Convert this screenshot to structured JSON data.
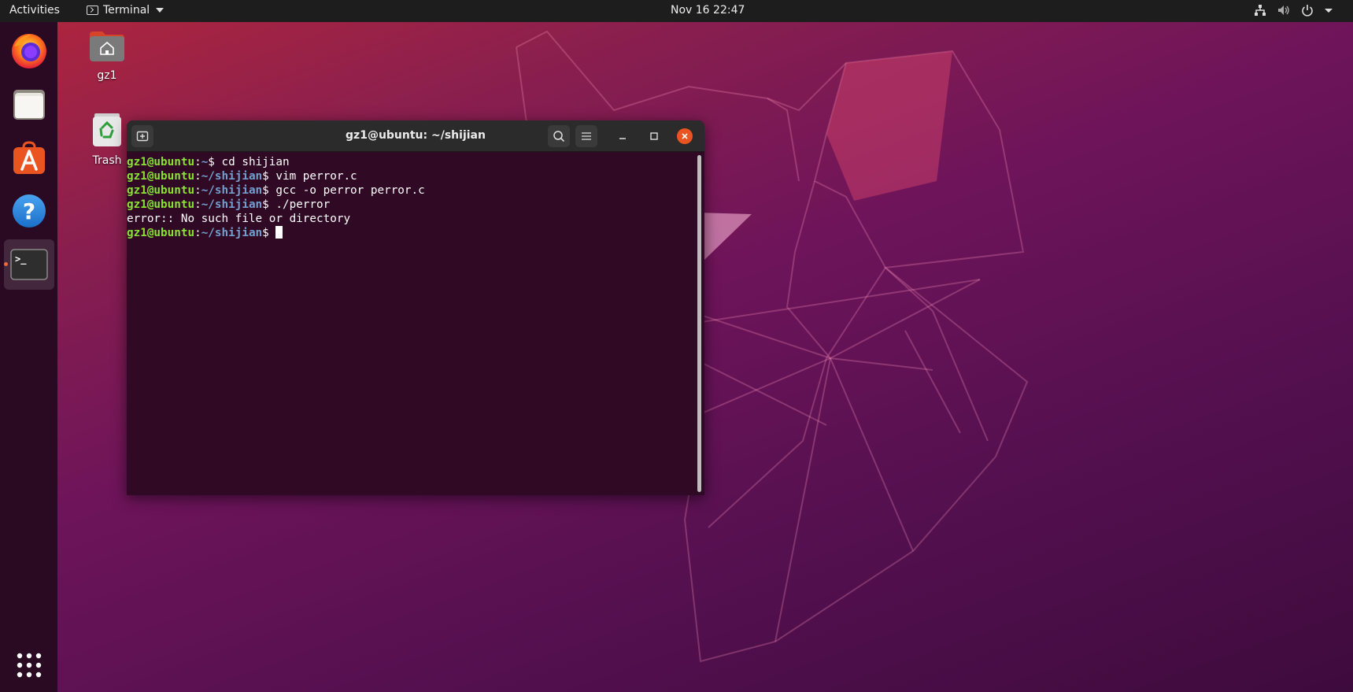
{
  "topbar": {
    "activities_label": "Activities",
    "app_menu_label": "Terminal",
    "clock": "Nov 16  22:47",
    "tray_icons": [
      "network-icon",
      "volume-icon",
      "power-icon",
      "chevron-down-icon"
    ]
  },
  "dock": {
    "items": [
      {
        "name": "firefox",
        "icon": "firefox-icon"
      },
      {
        "name": "files",
        "icon": "folder-icon"
      },
      {
        "name": "software",
        "icon": "app-store-icon"
      },
      {
        "name": "help",
        "icon": "help-icon"
      },
      {
        "name": "terminal",
        "icon": "terminal-icon",
        "active": true
      }
    ],
    "show_apps_icon": "grid-icon",
    "terminal_glyph": ">_"
  },
  "desktop": {
    "icons": [
      {
        "label": "gz1",
        "icon": "home-folder-icon"
      },
      {
        "label": "Trash",
        "icon": "trash-icon"
      }
    ]
  },
  "terminal": {
    "title": "gz1@ubuntu: ~/shijian",
    "lines": [
      {
        "user": "gz1@ubuntu",
        "sep": ":",
        "path": "~",
        "prompt": "$ ",
        "cmd": "cd shijian"
      },
      {
        "user": "gz1@ubuntu",
        "sep": ":",
        "path": "~/shijian",
        "prompt": "$ ",
        "cmd": "vim perror.c"
      },
      {
        "user": "gz1@ubuntu",
        "sep": ":",
        "path": "~/shijian",
        "prompt": "$ ",
        "cmd": "gcc -o perror perror.c"
      },
      {
        "user": "gz1@ubuntu",
        "sep": ":",
        "path": "~/shijian",
        "prompt": "$ ",
        "cmd": "./perror"
      },
      {
        "output": "error:: No such file or directory"
      },
      {
        "user": "gz1@ubuntu",
        "sep": ":",
        "path": "~/shijian",
        "prompt": "$ ",
        "cmd": ""
      }
    ]
  },
  "colors": {
    "ubuntu_orange": "#e95420",
    "terminal_bg": "#300a24",
    "prompt_user": "#8ae234",
    "prompt_path": "#729fcf"
  }
}
